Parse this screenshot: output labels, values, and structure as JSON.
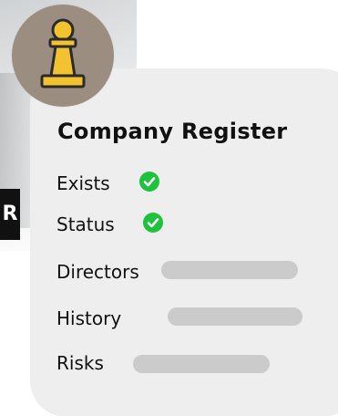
{
  "side_tag": {
    "text": "R"
  },
  "badge": {
    "icon": "chess-pawn-icon",
    "accent": "#f2c230",
    "bg": "#9b8e81"
  },
  "card": {
    "title": "Company Register",
    "rows": [
      {
        "label": "Exists",
        "state": "check",
        "icon": "check-circle-icon",
        "color": "#1ec23d"
      },
      {
        "label": "Status",
        "state": "check",
        "icon": "check-circle-icon",
        "color": "#1ec23d"
      },
      {
        "label": "Directors",
        "state": "placeholder"
      },
      {
        "label": "History",
        "state": "placeholder"
      },
      {
        "label": "Risks",
        "state": "placeholder"
      }
    ]
  },
  "colors": {
    "card_bg": "#eeeeee",
    "placeholder": "#cbcbcb",
    "check_green": "#1ec23d",
    "text": "#111111"
  }
}
